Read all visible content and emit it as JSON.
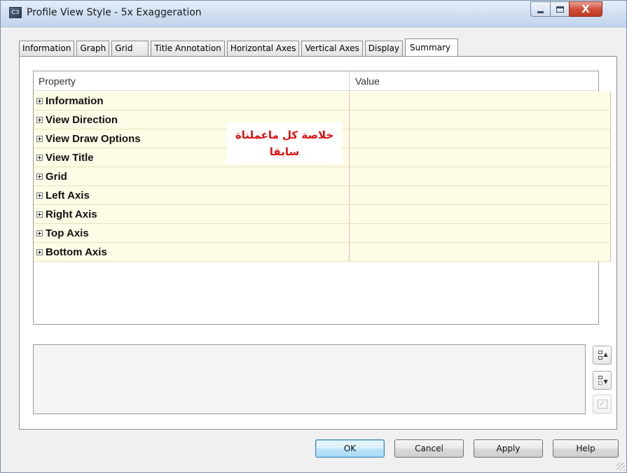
{
  "window": {
    "title": "Profile View Style - 5x Exaggeration",
    "close_glyph": "X"
  },
  "tabs": [
    {
      "label": "Information"
    },
    {
      "label": "Graph"
    },
    {
      "label": "Grid"
    },
    {
      "label": "Title Annotation"
    },
    {
      "label": "Horizontal Axes"
    },
    {
      "label": "Vertical Axes"
    },
    {
      "label": "Display"
    },
    {
      "label": "Summary",
      "active": true
    }
  ],
  "grid": {
    "columns": [
      "Property",
      "Value"
    ],
    "rows": [
      {
        "label": "Information"
      },
      {
        "label": "View Direction"
      },
      {
        "label": "View Draw Options"
      },
      {
        "label": "View Title"
      },
      {
        "label": "Grid"
      },
      {
        "label": "Left Axis"
      },
      {
        "label": "Right Axis"
      },
      {
        "label": "Top Axis"
      },
      {
        "label": "Bottom Axis"
      }
    ]
  },
  "overlay_note": {
    "line1": "خلاصة كل ماعملناة",
    "line2": "سابقا",
    "color": "#e01010"
  },
  "side_buttons": [
    {
      "icon": "sort-ascending-icon"
    },
    {
      "icon": "sort-descending-icon"
    },
    {
      "icon": "check-edit-icon",
      "disabled": true
    }
  ],
  "buttons": {
    "ok": "OK",
    "cancel": "Cancel",
    "apply": "Apply",
    "help": "Help"
  }
}
